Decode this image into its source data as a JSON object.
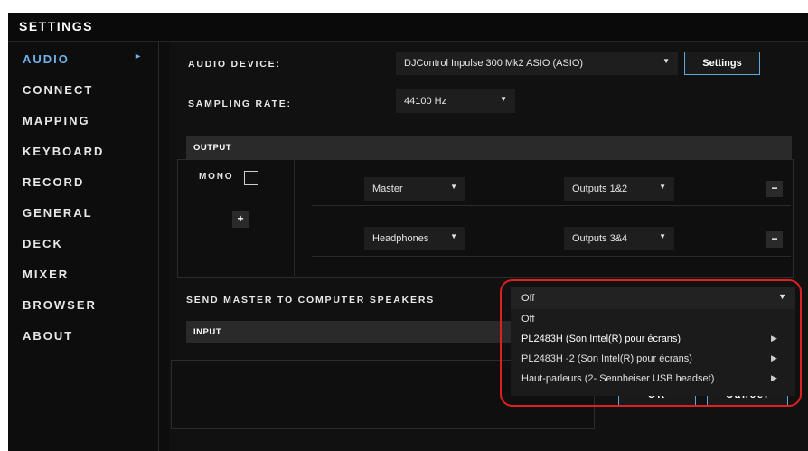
{
  "window": {
    "title": "SETTINGS"
  },
  "sidebar": {
    "items": [
      {
        "label": "AUDIO",
        "active": true
      },
      {
        "label": "CONNECT"
      },
      {
        "label": "MAPPING"
      },
      {
        "label": "KEYBOARD"
      },
      {
        "label": "RECORD"
      },
      {
        "label": "GENERAL"
      },
      {
        "label": "DECK"
      },
      {
        "label": "MIXER"
      },
      {
        "label": "BROWSER"
      },
      {
        "label": "ABOUT"
      }
    ],
    "active_marker": "▸"
  },
  "audio": {
    "device_label": "AUDIO DEVICE:",
    "device_value": "DJControl Inpulse 300 Mk2 ASIO (ASIO)",
    "settings_button": "Settings",
    "sampling_label": "SAMPLING RATE:",
    "sampling_value": "44100 Hz"
  },
  "output": {
    "header": "OUTPUT",
    "mono_label": "MONO",
    "add_symbol": "+",
    "rows": [
      {
        "channel": "Master",
        "route": "Outputs 1&2",
        "remove": "−"
      },
      {
        "channel": "Headphones",
        "route": "Outputs 3&4",
        "remove": "−"
      }
    ]
  },
  "send_master": {
    "label": "SEND MASTER TO COMPUTER SPEAKERS",
    "selected": "Off",
    "options": [
      {
        "label": "Off",
        "submenu": false
      },
      {
        "label": "PL2483H (Son Intel(R) pour écrans)",
        "submenu": true
      },
      {
        "label": "PL2483H -2 (Son Intel(R) pour écrans)",
        "submenu": true
      },
      {
        "label": "Haut-parleurs (2- Sennheiser USB headset)",
        "submenu": true
      }
    ]
  },
  "input": {
    "header": "INPUT"
  },
  "footer": {
    "ok": "OK",
    "cancel": "Cancel"
  },
  "icons": {
    "dropdown": "▼",
    "submenu": "▶"
  },
  "colors": {
    "accent": "#6fb2e8",
    "highlight_ring": "#e0201f"
  }
}
